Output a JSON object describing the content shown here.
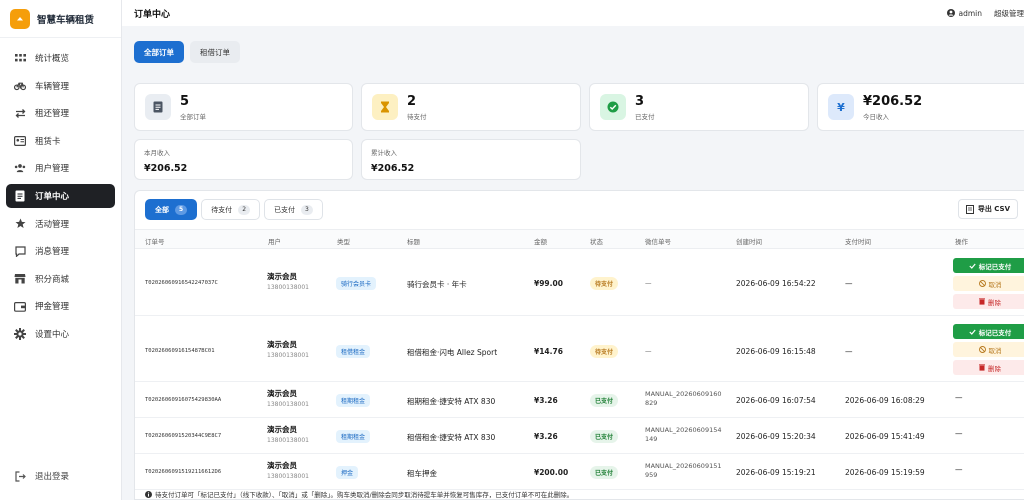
{
  "brand": {
    "name": "智慧车辆租赁"
  },
  "sidebar": {
    "items": [
      {
        "label": "统计概览",
        "icon": "grid-icon",
        "active": false
      },
      {
        "label": "车辆管理",
        "icon": "bicycle-icon",
        "active": false
      },
      {
        "label": "租还管理",
        "icon": "swap-icon",
        "active": false
      },
      {
        "label": "租赁卡",
        "icon": "id-card-icon",
        "active": false
      },
      {
        "label": "用户管理",
        "icon": "users-icon",
        "active": false
      },
      {
        "label": "订单中心",
        "icon": "document-icon",
        "active": true
      },
      {
        "label": "活动管理",
        "icon": "star-icon",
        "active": false
      },
      {
        "label": "消息管理",
        "icon": "message-icon",
        "active": false
      },
      {
        "label": "积分商城",
        "icon": "store-icon",
        "active": false
      },
      {
        "label": "押金管理",
        "icon": "wallet-icon",
        "active": false
      },
      {
        "label": "设置中心",
        "icon": "gear-icon",
        "active": false
      }
    ],
    "logout_label": "退出登录"
  },
  "header": {
    "title": "订单中心",
    "user": "admin",
    "role": "超级管理"
  },
  "tabs": [
    {
      "label": "全部订单",
      "active": true
    },
    {
      "label": "租借订单",
      "active": false
    }
  ],
  "stats": [
    {
      "value": "5",
      "label": "全部订单",
      "icon": "document-icon",
      "color": "#e9edf2"
    },
    {
      "value": "2",
      "label": "待支付",
      "icon": "hourglass-icon",
      "color": "#fdf0c2"
    },
    {
      "value": "3",
      "label": "已支付",
      "icon": "check-circle-icon",
      "color": "#d9f5e3"
    },
    {
      "value": "¥206.52",
      "label": "今日收入",
      "icon": "yen-icon",
      "color": "#dde9fb"
    }
  ],
  "summary": [
    {
      "label": "本月收入",
      "value": "¥206.52"
    },
    {
      "label": "累计收入",
      "value": "¥206.52"
    }
  ],
  "filters": [
    {
      "label": "全部",
      "count": "5",
      "active": true
    },
    {
      "label": "待支付",
      "count": "2",
      "active": false
    },
    {
      "label": "已支付",
      "count": "3",
      "active": false
    }
  ],
  "export_label": "导出 CSV",
  "table": {
    "headers": [
      "订单号",
      "用户",
      "类型",
      "标题",
      "金额",
      "状态",
      "微信单号",
      "创建时间",
      "支付时间",
      "操作"
    ],
    "rows": [
      {
        "order_no": "T02026060916542247037C",
        "user": "演示会员",
        "phone": "13800138001",
        "type": "骑行会员卡",
        "title": "骑行会员卡 · 年卡",
        "amount": "¥99.00",
        "status": "待支付",
        "status_kind": "pending",
        "wx": "—",
        "wx2": "",
        "created": "2026-06-09 16:54:22",
        "paid": "—",
        "actions": [
          "标记已支付",
          "取消",
          "删除"
        ]
      },
      {
        "order_no": "T0202606091615487BC01",
        "user": "演示会员",
        "phone": "13800138001",
        "type": "租借租金",
        "title": "租借租金·闪电 Allez Sport",
        "amount": "¥14.76",
        "status": "待支付",
        "status_kind": "pending",
        "wx": "—",
        "wx2": "",
        "created": "2026-06-09 16:15:48",
        "paid": "—",
        "actions": [
          "标记已支付",
          "取消",
          "删除"
        ]
      },
      {
        "order_no": "T02026060916075429830AA",
        "user": "演示会员",
        "phone": "13800138001",
        "type": "租期租金",
        "title": "租期租金·捷安特 ATX 830",
        "amount": "¥3.26",
        "status": "已支付",
        "status_kind": "paid",
        "wx": "MANUAL_20260609160",
        "wx2": "829",
        "created": "2026-06-09 16:07:54",
        "paid": "2026-06-09 16:08:29",
        "actions": [
          "—"
        ]
      },
      {
        "order_no": "T0202606091520344C9E8C7",
        "user": "演示会员",
        "phone": "13800138001",
        "type": "租期租金",
        "title": "租借租金·捷安特 ATX 830",
        "amount": "¥3.26",
        "status": "已支付",
        "status_kind": "paid",
        "wx": "MANUAL_20260609154",
        "wx2": "149",
        "created": "2026-06-09 15:20:34",
        "paid": "2026-06-09 15:41:49",
        "actions": [
          "—"
        ]
      },
      {
        "order_no": "T02026060915192116612D6",
        "user": "演示会员",
        "phone": "13800138001",
        "type": "押金",
        "title": "租车押金",
        "amount": "¥200.00",
        "status": "已支付",
        "status_kind": "paid",
        "wx": "MANUAL_20260609151",
        "wx2": "959",
        "created": "2026-06-09 15:19:21",
        "paid": "2026-06-09 15:19:59",
        "actions": [
          "—"
        ]
      }
    ]
  },
  "footnote": "待支付订单可「标记已支付」（线下收款）、「取消」或「删除」。购车类取消/删除会同步取消待提车单并恢复可售库存，已支付订单不可在此删除。",
  "colors": {
    "primary": "#1d6fd0",
    "success": "#1f9d46",
    "warning": "#b7791f",
    "danger": "#c62828",
    "brand": "#f59e0b"
  }
}
